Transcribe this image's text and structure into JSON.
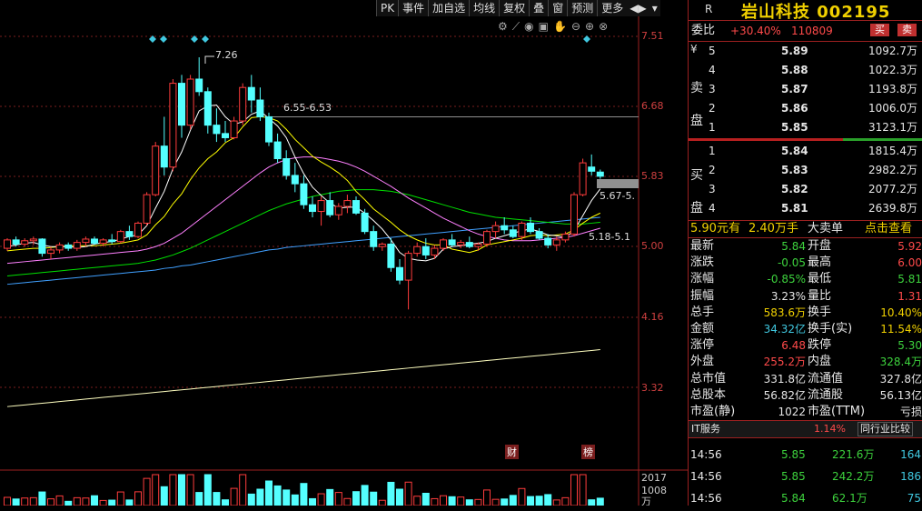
{
  "toolbar": {
    "items": [
      "PK",
      "事件",
      "加自选",
      "均线",
      "复权",
      "叠",
      "窗",
      "预测",
      "更多"
    ]
  },
  "chart": {
    "price_labels": [
      "7.51",
      "6.68",
      "5.83",
      "5.00",
      "4.16",
      "3.32"
    ],
    "annotation_high": "7.26",
    "annotation_range1": "6.55-6.53",
    "annotation_range2": "5.67-5.",
    "annotation_range3": "5.18-5.1",
    "marker_cai": "财",
    "marker_bang": "榜",
    "vol_label1": "2017",
    "vol_label2": "1008",
    "vol_unit": "万",
    "colors": {
      "up": "#ff3c3c",
      "down": "#54ffff",
      "ma5": "#ffffff",
      "ma10": "#ffff00",
      "ma20": "#ff80ff",
      "ma30": "#00e000",
      "ma60": "#40a0ff",
      "ma250": "#ffffc0"
    },
    "candles": [
      [
        4.98,
        5.1,
        4.95,
        5.08
      ],
      [
        5.08,
        5.12,
        5.0,
        5.03
      ],
      [
        5.03,
        5.1,
        5.0,
        5.07
      ],
      [
        5.07,
        5.12,
        5.02,
        5.09
      ],
      [
        5.09,
        5.1,
        4.88,
        4.92
      ],
      [
        4.92,
        5.0,
        4.85,
        4.96
      ],
      [
        4.96,
        5.05,
        4.92,
        5.02
      ],
      [
        5.02,
        5.05,
        4.95,
        4.98
      ],
      [
        4.98,
        5.08,
        4.95,
        5.05
      ],
      [
        5.05,
        5.12,
        5.0,
        5.09
      ],
      [
        5.09,
        5.12,
        5.02,
        5.04
      ],
      [
        5.04,
        5.1,
        5.0,
        5.08
      ],
      [
        5.08,
        5.15,
        5.03,
        5.06
      ],
      [
        5.06,
        5.2,
        5.04,
        5.18
      ],
      [
        5.18,
        5.25,
        5.08,
        5.12
      ],
      [
        5.12,
        5.3,
        5.1,
        5.28
      ],
      [
        5.28,
        5.65,
        5.25,
        5.62
      ],
      [
        5.62,
        6.25,
        5.6,
        6.2
      ],
      [
        6.2,
        6.55,
        5.85,
        5.95
      ],
      [
        5.95,
        7.0,
        5.9,
        6.95
      ],
      [
        6.95,
        7.05,
        6.3,
        6.45
      ],
      [
        6.45,
        7.05,
        6.4,
        7.0
      ],
      [
        7.0,
        7.26,
        6.8,
        6.85
      ],
      [
        6.85,
        6.9,
        6.35,
        6.45
      ],
      [
        6.45,
        6.65,
        6.25,
        6.35
      ],
      [
        6.35,
        6.5,
        6.25,
        6.3
      ],
      [
        6.3,
        6.55,
        6.28,
        6.5
      ],
      [
        6.5,
        6.95,
        6.45,
        6.9
      ],
      [
        6.9,
        7.05,
        6.6,
        6.75
      ],
      [
        6.75,
        6.9,
        6.5,
        6.55
      ],
      [
        6.55,
        6.6,
        6.2,
        6.25
      ],
      [
        6.25,
        6.35,
        6.0,
        6.05
      ],
      [
        6.05,
        6.15,
        5.8,
        5.85
      ],
      [
        5.85,
        6.0,
        5.65,
        5.75
      ],
      [
        5.75,
        5.85,
        5.45,
        5.5
      ],
      [
        5.5,
        5.6,
        5.35,
        5.42
      ],
      [
        5.42,
        5.6,
        5.25,
        5.55
      ],
      [
        5.55,
        5.65,
        5.35,
        5.38
      ],
      [
        5.38,
        5.52,
        5.32,
        5.48
      ],
      [
        5.48,
        5.62,
        5.4,
        5.55
      ],
      [
        5.55,
        5.6,
        5.38,
        5.4
      ],
      [
        5.4,
        5.45,
        5.15,
        5.18
      ],
      [
        5.18,
        5.25,
        4.95,
        5.0
      ],
      [
        5.0,
        5.05,
        4.95,
        5.03
      ],
      [
        5.03,
        5.1,
        4.7,
        4.75
      ],
      [
        4.75,
        4.85,
        4.55,
        4.6
      ],
      [
        4.6,
        4.95,
        4.25,
        4.92
      ],
      [
        4.92,
        5.05,
        4.88,
        5.0
      ],
      [
        5.0,
        5.1,
        4.85,
        4.9
      ],
      [
        4.9,
        5.02,
        4.85,
        4.98
      ],
      [
        4.98,
        5.1,
        4.95,
        5.08
      ],
      [
        5.08,
        5.15,
        5.0,
        5.02
      ],
      [
        5.02,
        5.08,
        4.98,
        5.05
      ],
      [
        5.05,
        5.12,
        4.98,
        5.0
      ],
      [
        5.0,
        5.05,
        4.95,
        5.03
      ],
      [
        5.03,
        5.2,
        5.0,
        5.18
      ],
      [
        5.18,
        5.3,
        5.1,
        5.25
      ],
      [
        5.25,
        5.35,
        5.15,
        5.2
      ],
      [
        5.2,
        5.25,
        5.1,
        5.12
      ],
      [
        5.12,
        5.3,
        5.08,
        5.28
      ],
      [
        5.28,
        5.35,
        5.15,
        5.18
      ],
      [
        5.18,
        5.22,
        5.08,
        5.1
      ],
      [
        5.1,
        5.15,
        4.98,
        5.02
      ],
      [
        5.02,
        5.12,
        4.95,
        5.08
      ],
      [
        5.08,
        5.18,
        5.05,
        5.15
      ],
      [
        5.15,
        5.65,
        5.12,
        5.62
      ],
      [
        5.62,
        6.05,
        5.6,
        6.0
      ],
      [
        5.95,
        6.1,
        5.85,
        5.9
      ],
      [
        5.89,
        5.92,
        5.81,
        5.84
      ]
    ],
    "ma5": [
      5.0,
      5.02,
      5.04,
      5.05,
      5.02,
      5.0,
      5.0,
      5.0,
      4.99,
      5.0,
      5.03,
      5.05,
      5.06,
      5.09,
      5.12,
      5.14,
      5.25,
      5.46,
      5.66,
      5.93,
      6.13,
      6.39,
      6.62,
      6.68,
      6.69,
      6.55,
      6.46,
      6.49,
      6.58,
      6.62,
      6.53,
      6.44,
      6.3,
      6.07,
      5.87,
      5.71,
      5.61,
      5.52,
      5.46,
      5.47,
      5.47,
      5.4,
      5.31,
      5.21,
      5.08,
      4.93,
      4.86,
      4.84,
      4.83,
      4.86,
      4.97,
      5.0,
      5.01,
      5.03,
      5.04,
      5.06,
      5.1,
      5.13,
      5.16,
      5.19,
      5.21,
      5.18,
      5.14,
      5.13,
      5.11,
      5.19,
      5.37,
      5.55,
      5.69
    ],
    "ma10": [
      4.95,
      4.96,
      4.97,
      4.98,
      4.98,
      4.99,
      5.0,
      5.01,
      5.01,
      5.01,
      5.01,
      5.02,
      5.03,
      5.04,
      5.06,
      5.08,
      5.14,
      5.26,
      5.36,
      5.51,
      5.63,
      5.8,
      5.94,
      6.05,
      6.13,
      6.24,
      6.3,
      6.43,
      6.54,
      6.55,
      6.54,
      6.5,
      6.4,
      6.28,
      6.18,
      6.08,
      6.01,
      5.95,
      5.88,
      5.79,
      5.66,
      5.56,
      5.45,
      5.37,
      5.29,
      5.2,
      5.13,
      5.08,
      5.04,
      5.02,
      5.02,
      4.97,
      4.95,
      4.93,
      4.96,
      5.02,
      5.04,
      5.06,
      5.08,
      5.1,
      5.13,
      5.14,
      5.13,
      5.14,
      5.15,
      5.2,
      5.28,
      5.35,
      5.4
    ],
    "ma20": [
      4.8,
      4.81,
      4.82,
      4.83,
      4.84,
      4.85,
      4.86,
      4.87,
      4.88,
      4.89,
      4.9,
      4.91,
      4.92,
      4.93,
      4.94,
      4.95,
      4.97,
      5.0,
      5.04,
      5.1,
      5.16,
      5.24,
      5.32,
      5.4,
      5.48,
      5.56,
      5.64,
      5.72,
      5.8,
      5.88,
      5.95,
      6.0,
      6.04,
      6.06,
      6.07,
      6.07,
      6.06,
      6.04,
      6.02,
      5.99,
      5.95,
      5.9,
      5.84,
      5.78,
      5.72,
      5.65,
      5.58,
      5.52,
      5.46,
      5.4,
      5.34,
      5.29,
      5.24,
      5.19,
      5.15,
      5.12,
      5.1,
      5.08,
      5.07,
      5.07,
      5.07,
      5.08,
      5.09,
      5.1,
      5.11,
      5.13,
      5.16,
      5.19,
      5.22
    ],
    "ma30": [
      4.65,
      4.66,
      4.67,
      4.68,
      4.69,
      4.7,
      4.71,
      4.72,
      4.73,
      4.74,
      4.75,
      4.76,
      4.77,
      4.78,
      4.79,
      4.8,
      4.82,
      4.84,
      4.87,
      4.9,
      4.94,
      4.98,
      5.03,
      5.08,
      5.13,
      5.18,
      5.23,
      5.28,
      5.33,
      5.38,
      5.43,
      5.47,
      5.51,
      5.54,
      5.57,
      5.6,
      5.62,
      5.64,
      5.66,
      5.67,
      5.68,
      5.68,
      5.68,
      5.67,
      5.66,
      5.64,
      5.62,
      5.59,
      5.56,
      5.53,
      5.5,
      5.47,
      5.44,
      5.41,
      5.39,
      5.37,
      5.35,
      5.34,
      5.33,
      5.32,
      5.31,
      5.3,
      5.29,
      5.28,
      5.27,
      5.27,
      5.27,
      5.28,
      5.29
    ],
    "ma60": [
      4.55,
      4.56,
      4.57,
      4.58,
      4.59,
      4.6,
      4.61,
      4.62,
      4.63,
      4.64,
      4.65,
      4.66,
      4.67,
      4.68,
      4.69,
      4.7,
      4.71,
      4.72,
      4.74,
      4.75,
      4.77,
      4.78,
      4.8,
      4.82,
      4.84,
      4.86,
      4.88,
      4.9,
      4.92,
      4.94,
      4.96,
      4.97,
      4.99,
      5.0,
      5.01,
      5.02,
      5.03,
      5.04,
      5.05,
      5.06,
      5.07,
      5.08,
      5.09,
      5.1,
      5.11,
      5.12,
      5.13,
      5.14,
      5.15,
      5.16,
      5.17,
      5.18,
      5.19,
      5.2,
      5.21,
      5.22,
      5.23,
      5.24,
      5.25,
      5.26,
      5.27,
      5.28,
      5.29,
      5.3,
      5.31,
      5.32,
      5.33,
      5.34,
      5.35
    ],
    "ma250": [
      3.09,
      3.1,
      3.11,
      3.12,
      3.13,
      3.14,
      3.15,
      3.16,
      3.17,
      3.18,
      3.19,
      3.2,
      3.21,
      3.22,
      3.23,
      3.24,
      3.25,
      3.26,
      3.27,
      3.28,
      3.29,
      3.3,
      3.31,
      3.32,
      3.33,
      3.34,
      3.35,
      3.36,
      3.37,
      3.38,
      3.39,
      3.4,
      3.41,
      3.42,
      3.43,
      3.44,
      3.45,
      3.46,
      3.47,
      3.48,
      3.49,
      3.5,
      3.51,
      3.52,
      3.53,
      3.54,
      3.55,
      3.56,
      3.57,
      3.58,
      3.59,
      3.6,
      3.61,
      3.62,
      3.63,
      3.64,
      3.65,
      3.66,
      3.67,
      3.68,
      3.69,
      3.7,
      3.71,
      3.72,
      3.73,
      3.74,
      3.75,
      3.76,
      3.77
    ]
  },
  "quote": {
    "r_mark": "R",
    "name": "岩山科技 002195",
    "weibi_label": "委比",
    "weibi_value": "+30.40%",
    "weibi_diff": "110809",
    "buy_btn": "买",
    "sell_btn": "卖",
    "sell_side_labels": [
      "¥",
      "卖",
      "盘"
    ],
    "buy_side_labels": [
      "买",
      "盘"
    ],
    "sells": [
      {
        "level": "5",
        "price": "5.89",
        "vol": "1092.7万"
      },
      {
        "level": "4",
        "price": "5.88",
        "vol": "1022.3万"
      },
      {
        "level": "3",
        "price": "5.87",
        "vol": "1193.8万"
      },
      {
        "level": "2",
        "price": "5.86",
        "vol": "1006.0万"
      },
      {
        "level": "1",
        "price": "5.85",
        "vol": "3123.1万"
      }
    ],
    "buys": [
      {
        "level": "1",
        "price": "5.84",
        "vol": "1815.4万"
      },
      {
        "level": "2",
        "price": "5.83",
        "vol": "2982.2万"
      },
      {
        "level": "3",
        "price": "5.82",
        "vol": "2077.2万"
      },
      {
        "level": "4",
        "price": "5.81",
        "vol": "2639.8万"
      }
    ],
    "bigorder": {
      "a": "5.90元有",
      "b": "2.40万手",
      "c": "大卖单",
      "d": "点击查看"
    },
    "stats": [
      {
        "l1": "最新",
        "v1": "5.84",
        "c1": "green",
        "l2": "开盘",
        "v2": "5.92",
        "c2": "red"
      },
      {
        "l1": "涨跌",
        "v1": "-0.05",
        "c1": "green",
        "l2": "最高",
        "v2": "6.00",
        "c2": "red"
      },
      {
        "l1": "涨幅",
        "v1": "-0.85%",
        "c1": "green",
        "l2": "最低",
        "v2": "5.81",
        "c2": "green"
      },
      {
        "l1": "振幅",
        "v1": "3.23%",
        "c1": "white",
        "l2": "量比",
        "v2": "1.31",
        "c2": "red"
      },
      {
        "l1": "总手",
        "v1": "583.6万",
        "c1": "yellow",
        "l2": "换手",
        "v2": "10.40%",
        "c2": "yellow"
      },
      {
        "l1": "金额",
        "v1": "34.32亿",
        "c1": "cyan",
        "l2": "换手(实)",
        "v2": "11.54%",
        "c2": "yellow"
      },
      {
        "l1": "涨停",
        "v1": "6.48",
        "c1": "red",
        "l2": "跌停",
        "v2": "5.30",
        "c2": "green"
      },
      {
        "l1": "外盘",
        "v1": "255.2万",
        "c1": "red",
        "l2": "内盘",
        "v2": "328.4万",
        "c2": "green"
      },
      {
        "l1": "总市值",
        "v1": "331.8亿",
        "c1": "white",
        "l2": "流通值",
        "v2": "327.8亿",
        "c2": "white"
      },
      {
        "l1": "总股本",
        "v1": "56.82亿",
        "c1": "white",
        "l2": "流通股",
        "v2": "56.13亿",
        "c2": "white"
      },
      {
        "l1": "市盈(静)",
        "v1": "1022",
        "c1": "white",
        "l2": "市盈(TTM)",
        "v2": "亏损",
        "c2": "white"
      }
    ],
    "industry": {
      "name": "IT服务",
      "pct": "1.14%",
      "btn": "同行业比较"
    },
    "ticks": [
      {
        "time": "14:56",
        "price": "5.85",
        "vol": "221.6万",
        "n": "164"
      },
      {
        "time": "14:56",
        "price": "5.85",
        "vol": "242.2万",
        "n": "186"
      },
      {
        "time": "14:56",
        "price": "5.84",
        "vol": "62.1万",
        "n": "75"
      }
    ]
  }
}
